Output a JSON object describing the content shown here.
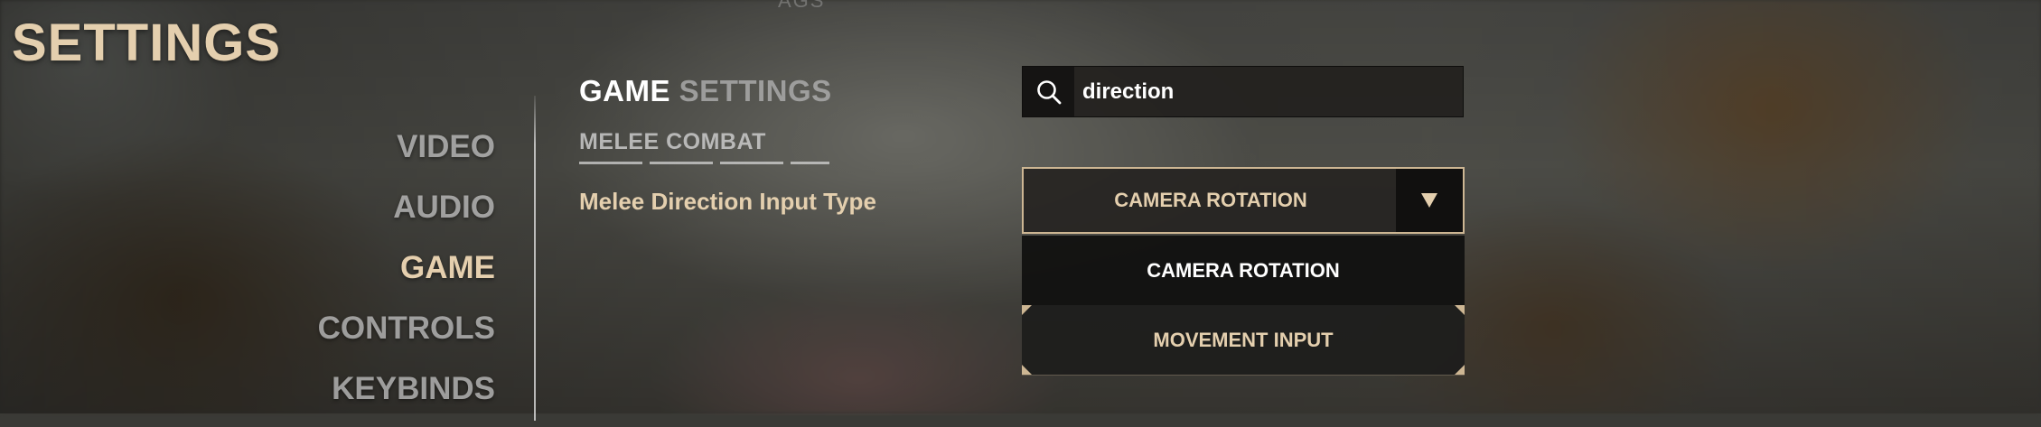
{
  "header": {
    "title": "SETTINGS",
    "top_faint_text": "AGS"
  },
  "nav": {
    "items": [
      {
        "label": "VIDEO",
        "active": false
      },
      {
        "label": "AUDIO",
        "active": false
      },
      {
        "label": "GAME",
        "active": true
      },
      {
        "label": "CONTROLS",
        "active": false
      },
      {
        "label": "KEYBINDS",
        "active": false
      }
    ]
  },
  "main": {
    "title_primary": "GAME",
    "title_secondary": "SETTINGS",
    "category": "MELEE COMBAT",
    "setting_label": "Melee Direction Input Type"
  },
  "search": {
    "value": "direction",
    "icon": "search-icon"
  },
  "dropdown": {
    "current_value": "CAMERA ROTATION",
    "arrow_icon": "triangle-down-icon",
    "options": [
      {
        "label": "CAMERA ROTATION",
        "selected": true
      },
      {
        "label": "MOVEMENT INPUT",
        "selected": false
      }
    ]
  },
  "colors": {
    "accent_gold": "#e4cfae",
    "border_gold": "#cdb693",
    "text_white": "#ffffff"
  }
}
